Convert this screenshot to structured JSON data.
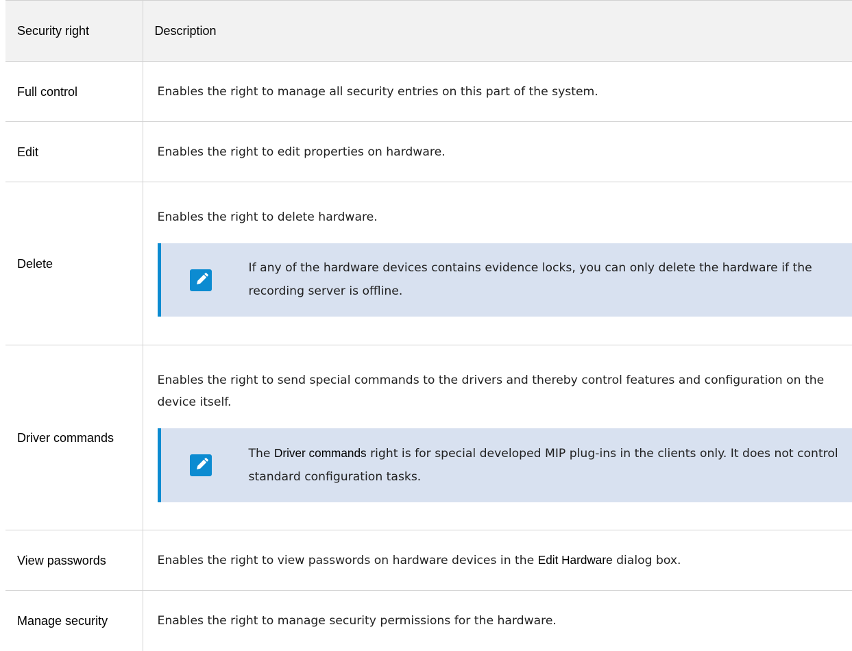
{
  "header": {
    "col1": "Security right",
    "col2": "Description"
  },
  "rows": [
    {
      "name": "Full control",
      "desc": "Enables the right to manage all security entries on this part of the system."
    },
    {
      "name": "Edit",
      "desc": "Enables the right to edit properties on hardware."
    },
    {
      "name": "Delete",
      "desc": "Enables the right to delete hardware.",
      "note": {
        "text": "If any of the hardware devices contains evidence locks, you can only delete the hardware if the recording server is offline."
      }
    },
    {
      "name": "Driver commands",
      "desc": "Enables the right to send special commands to the drivers and thereby control features and configuration on the device itself.",
      "note": {
        "pre": "The ",
        "bold": "Driver commands",
        "post": " right is for special developed MIP plug-ins in the clients only. It does not control standard configuration tasks."
      }
    },
    {
      "name": "View passwords",
      "desc_pre": "Enables the right to view passwords on hardware devices in the ",
      "desc_bold": "Edit Hardware",
      "desc_post": " dialog box."
    },
    {
      "name": "Manage security",
      "desc": "Enables the right to manage security permissions for the hardware."
    }
  ],
  "icon": "pencil-note-icon",
  "colors": {
    "accent": "#0c8bd1",
    "note_bg": "#d8e1f0",
    "header_bg": "#f2f2f2"
  }
}
